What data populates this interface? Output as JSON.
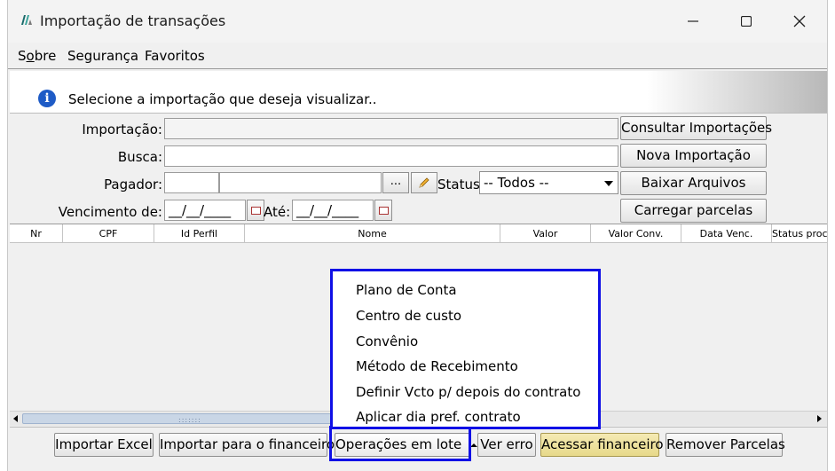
{
  "window": {
    "title": "Importação de transações",
    "controls": [
      "minimize",
      "maximize",
      "close"
    ]
  },
  "menu": {
    "items": [
      {
        "label": "Sobre",
        "mnemonic": "o"
      },
      {
        "label": "Segurança"
      },
      {
        "label": "Favoritos"
      }
    ]
  },
  "banner": {
    "icon": "info-icon",
    "text": "Selecione a importação que deseja visualizar.."
  },
  "form": {
    "importacao_label": "Importação:",
    "importacao_value": "",
    "busca_label": "Busca:",
    "busca_value": "",
    "pagador_label": "Pagador:",
    "pagador_code": "",
    "pagador_name": "",
    "pagador_browse": "...",
    "status_label": "Status:",
    "status_value": "-- Todos --",
    "vencimento_label": "Vencimento de:",
    "vencimento_de": "__/__/____",
    "ate_label": "Até:",
    "vencimento_ate": "__/__/____"
  },
  "side_buttons": {
    "consultar": "Consultar Importações",
    "nova": "Nova Importação",
    "baixar": "Baixar Arquivos",
    "carregar": "Carregar parcelas"
  },
  "table": {
    "columns": [
      "Nr",
      "CPF",
      "Id Perfil",
      "Nome",
      "Valor",
      "Valor Conv.",
      "Data Venc.",
      "Status proc"
    ],
    "rows": []
  },
  "popup_menu": {
    "items": [
      "Plano de Conta",
      "Centro de custo",
      "Convênio",
      "Método de Recebimento",
      "Definir Vcto p/ depois do contrato",
      "Aplicar dia pref. contrato"
    ]
  },
  "toolbar": {
    "importar_excel": "Importar Excel",
    "importar_financeiro": "Importar para o financeiro",
    "operacoes_lote": "Operações em lote",
    "ver_erro": "Ver erro",
    "acessar_financeiro": "Acessar financeiro",
    "remover_parcelas": "Remover Parcelas"
  },
  "colors": {
    "highlight_border": "#1010e6",
    "accent_button": "#efe39e",
    "info_blue": "#1e5bc6"
  }
}
